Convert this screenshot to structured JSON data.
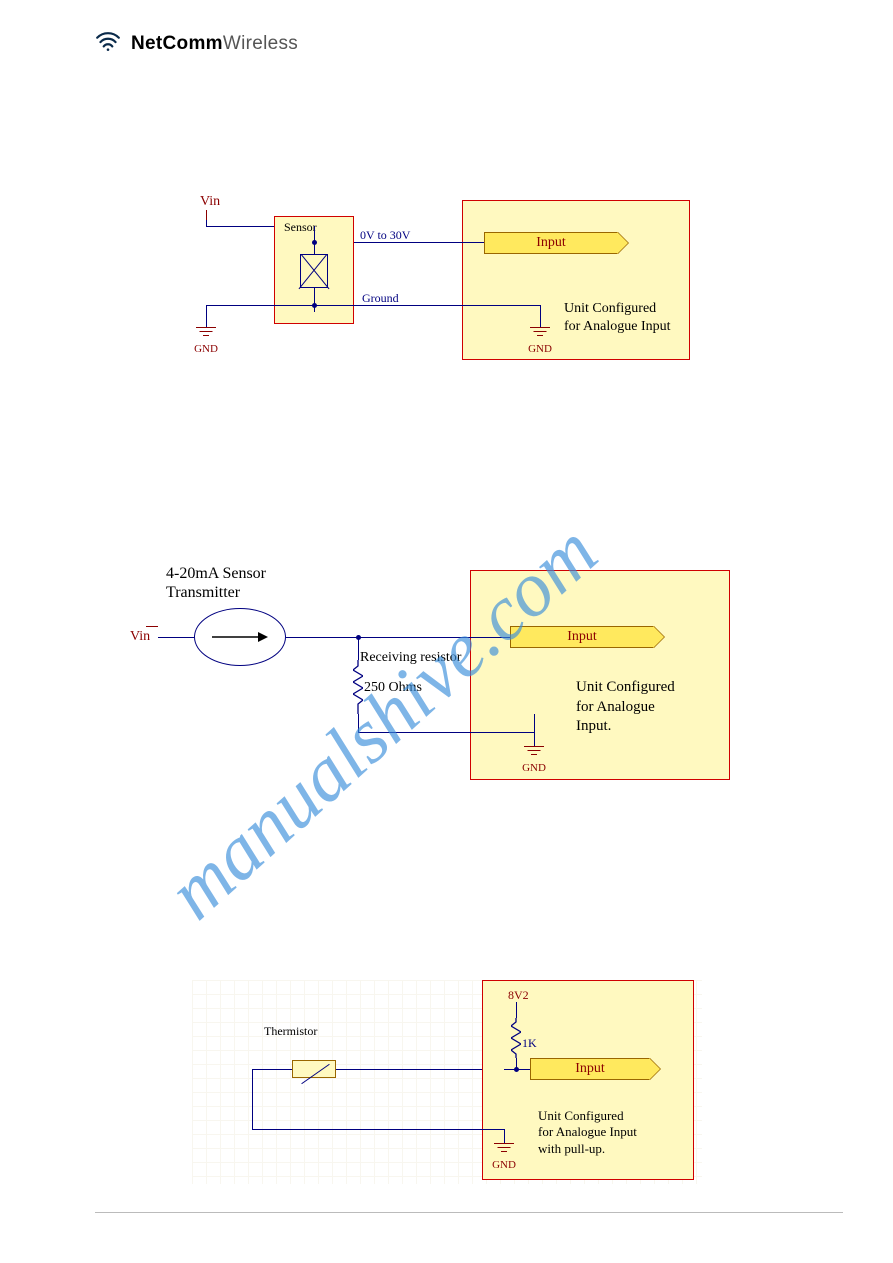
{
  "logo": {
    "brand_bold": "NetComm",
    "brand_light": "Wireless"
  },
  "watermark": "manualshive.com",
  "diagram1": {
    "vin": "Vin",
    "sensor": "Sensor",
    "signal_label": "0V to 30V",
    "ground_label": "Ground",
    "input": "Input",
    "unit_text_l1": "Unit Configured",
    "unit_text_l2": "for Analogue Input",
    "gnd": "GND"
  },
  "diagram2": {
    "title_l1": "4-20mA Sensor",
    "title_l2": "Transmitter",
    "vin": "Vin",
    "recv_label": "Receiving resistor",
    "recv_value": "250 Ohms",
    "input": "Input",
    "unit_text_l1": "Unit Configured",
    "unit_text_l2": "for Analogue",
    "unit_text_l3": "Input.",
    "gnd": "GND"
  },
  "diagram3": {
    "thermistor": "Thermistor",
    "voltage": "8V2",
    "res_value": "1K",
    "input": "Input",
    "unit_text_l1": "Unit Configured",
    "unit_text_l2": "for Analogue Input",
    "unit_text_l3": "with pull-up.",
    "gnd": "GND"
  }
}
